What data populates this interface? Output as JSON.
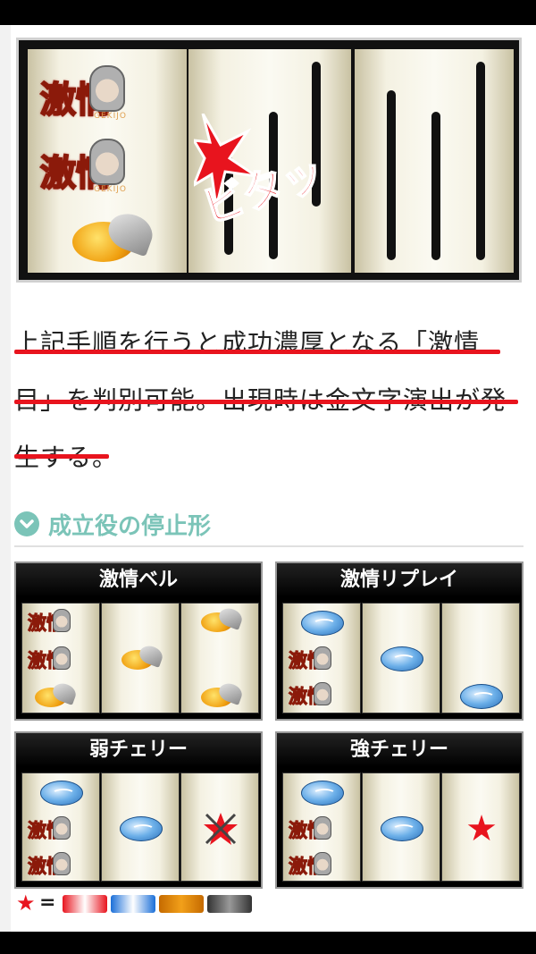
{
  "hero": {
    "reel_symbol_text": "激情",
    "reel_symbol_sub": "GEKIJO",
    "effect_text": "ビタッ"
  },
  "description": {
    "line1": "上記手順を行うと成功濃厚となる「激情",
    "line2": "目」を判別可能。出現時は金文字演出が発",
    "line3": "生する。"
  },
  "section": {
    "title": "成立役の停止形"
  },
  "panels": [
    {
      "title": "激情ベル"
    },
    {
      "title": "激情リプレイ"
    },
    {
      "title": "弱チェリー"
    },
    {
      "title": "強チェリー"
    }
  ],
  "symbols": {
    "gekijo": "激情",
    "star": "★"
  },
  "legend": {
    "star": "★",
    "equals": "="
  },
  "colors": {
    "accent_red": "#e8141e",
    "section_teal": "#7bc4b8"
  }
}
